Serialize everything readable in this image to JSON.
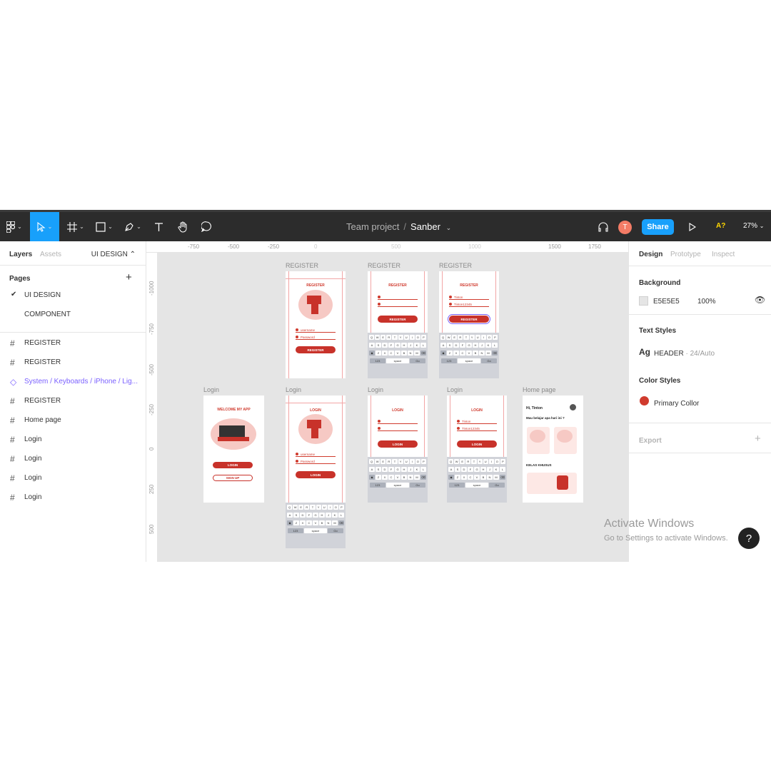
{
  "toolbar": {
    "project": "Team project",
    "separator": "/",
    "file": "Sanber",
    "user_initial": "T",
    "share_label": "Share",
    "a11y_label": "A?",
    "zoom": "27%"
  },
  "left_panel": {
    "tabs": [
      "Layers",
      "Assets"
    ],
    "page_selector": "UI DESIGN ⌃",
    "pages_heading": "Pages",
    "pages": [
      "UI DESIGN",
      "COMPONENT"
    ],
    "layers": [
      {
        "icon": "frame-icon",
        "label": "REGISTER"
      },
      {
        "icon": "frame-icon",
        "label": "REGISTER"
      },
      {
        "icon": "component-icon",
        "label": "System / Keyboards / iPhone / Lig..."
      },
      {
        "icon": "frame-icon",
        "label": "REGISTER"
      },
      {
        "icon": "frame-icon",
        "label": "Home page"
      },
      {
        "icon": "frame-icon",
        "label": "Login"
      },
      {
        "icon": "frame-icon",
        "label": "Login"
      },
      {
        "icon": "frame-icon",
        "label": "Login"
      },
      {
        "icon": "frame-icon",
        "label": "Login"
      }
    ]
  },
  "right_panel": {
    "tabs": [
      "Design",
      "Prototype",
      "Inspect"
    ],
    "background_heading": "Background",
    "background_hex": "E5E5E5",
    "background_opacity": "100%",
    "text_styles_heading": "Text Styles",
    "text_style_glyph": "Ag",
    "text_style_name": "HEADER",
    "text_style_meta": "· 24/Auto",
    "color_styles_heading": "Color Styles",
    "color_style_name": "Primary Collor",
    "color_style_hex": "#D03B2E",
    "export_heading": "Export"
  },
  "canvas": {
    "ruler_top": [
      "-750",
      "-500",
      "-250",
      "0",
      "500",
      "1000",
      "1500",
      "1750"
    ],
    "ruler_left": [
      "-1000",
      "-750",
      "-500",
      "-250",
      "0",
      "250",
      "500"
    ],
    "frame_labels": [
      "REGISTER",
      "REGISTER",
      "REGISTER",
      "Login",
      "Login",
      "Login",
      "Login",
      "Home page"
    ],
    "register_title": "REGISTER",
    "login_title": "LOGIN",
    "welcome_title": "WELCOME MY APP",
    "username_placeholder": "username",
    "password_placeholder": "Password",
    "filled_username": "Tinton",
    "filled_password": "Tinton12345",
    "register_button": "REGISTER",
    "login_button": "LOGIN",
    "signup_button": "SIGN UP",
    "home_greeting": "Hi, Tinton",
    "home_question": "Mau belajar apa hari ini ?",
    "home_section": "KELAS KHUSUS",
    "keyboard_rows": [
      [
        "Q",
        "W",
        "E",
        "R",
        "T",
        "Y",
        "U",
        "I",
        "O",
        "P"
      ],
      [
        "A",
        "S",
        "D",
        "F",
        "G",
        "H",
        "J",
        "K",
        "L"
      ],
      [
        "◆",
        "Z",
        "X",
        "C",
        "V",
        "B",
        "N",
        "M",
        "⌫"
      ]
    ],
    "keyboard_bottom": [
      "123",
      "space",
      "Go"
    ]
  },
  "system": {
    "activate_title": "Activate Windows",
    "activate_sub": "Go to Settings to activate Windows.",
    "help": "?"
  },
  "colors": {
    "brand": "#18A0FB",
    "primary": "#D03B2E",
    "canvas_bg": "#E5E5E5"
  }
}
